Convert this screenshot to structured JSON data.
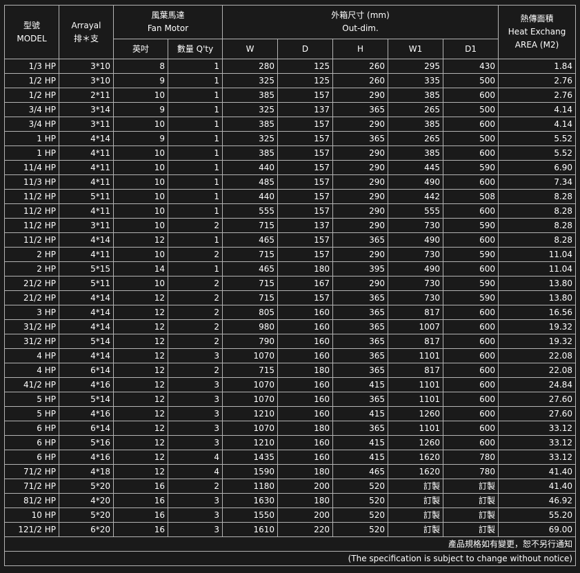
{
  "headers": {
    "model": [
      "型號",
      "MODEL"
    ],
    "arrayal": [
      "Arrayal",
      "排＊支"
    ],
    "fan_motor": [
      "風葉馬達",
      "Fan Motor"
    ],
    "out_dim": [
      "外箱尺寸 (mm)",
      "Out-dim."
    ],
    "heat": [
      "熱傳面積",
      "Heat Exchang",
      "AREA (M2)"
    ],
    "sub": [
      "英吋",
      "數量 Q'ty",
      "W",
      "D",
      "H",
      "W1",
      "D1"
    ]
  },
  "rows": [
    [
      "1/3 HP",
      "3*10",
      "8",
      "1",
      "280",
      "125",
      "260",
      "295",
      "430",
      "1.84"
    ],
    [
      "1/2 HP",
      "3*10",
      "9",
      "1",
      "325",
      "125",
      "260",
      "335",
      "500",
      "2.76"
    ],
    [
      "1/2 HP",
      "2*11",
      "10",
      "1",
      "385",
      "157",
      "290",
      "385",
      "600",
      "2.76"
    ],
    [
      "3/4 HP",
      "3*14",
      "9",
      "1",
      "325",
      "137",
      "365",
      "265",
      "500",
      "4.14"
    ],
    [
      "3/4 HP",
      "3*11",
      "10",
      "1",
      "385",
      "157",
      "290",
      "385",
      "600",
      "4.14"
    ],
    [
      "1 HP",
      "4*14",
      "9",
      "1",
      "325",
      "157",
      "365",
      "265",
      "500",
      "5.52"
    ],
    [
      "1 HP",
      "4*11",
      "10",
      "1",
      "385",
      "157",
      "290",
      "385",
      "600",
      "5.52"
    ],
    [
      "11/4 HP",
      "4*11",
      "10",
      "1",
      "440",
      "157",
      "290",
      "445",
      "590",
      "6.90"
    ],
    [
      "11/3 HP",
      "4*11",
      "10",
      "1",
      "485",
      "157",
      "290",
      "490",
      "600",
      "7.34"
    ],
    [
      "11/2 HP",
      "5*11",
      "10",
      "1",
      "440",
      "157",
      "290",
      "442",
      "508",
      "8.28"
    ],
    [
      "11/2 HP",
      "4*11",
      "10",
      "1",
      "555",
      "157",
      "290",
      "555",
      "600",
      "8.28"
    ],
    [
      "11/2 HP",
      "3*11",
      "10",
      "2",
      "715",
      "137",
      "290",
      "730",
      "590",
      "8.28"
    ],
    [
      "11/2 HP",
      "4*14",
      "12",
      "1",
      "465",
      "157",
      "365",
      "490",
      "600",
      "8.28"
    ],
    [
      "2 HP",
      "4*11",
      "10",
      "2",
      "715",
      "157",
      "290",
      "730",
      "590",
      "11.04"
    ],
    [
      "2 HP",
      "5*15",
      "14",
      "1",
      "465",
      "180",
      "395",
      "490",
      "600",
      "11.04"
    ],
    [
      "21/2 HP",
      "5*11",
      "10",
      "2",
      "715",
      "167",
      "290",
      "730",
      "590",
      "13.80"
    ],
    [
      "21/2 HP",
      "4*14",
      "12",
      "2",
      "715",
      "157",
      "365",
      "730",
      "590",
      "13.80"
    ],
    [
      "3 HP",
      "4*14",
      "12",
      "2",
      "805",
      "160",
      "365",
      "817",
      "600",
      "16.56"
    ],
    [
      "31/2 HP",
      "4*14",
      "12",
      "2",
      "980",
      "160",
      "365",
      "1007",
      "600",
      "19.32"
    ],
    [
      "31/2 HP",
      "5*14",
      "12",
      "2",
      "790",
      "160",
      "365",
      "817",
      "600",
      "19.32"
    ],
    [
      "4 HP",
      "4*14",
      "12",
      "3",
      "1070",
      "160",
      "365",
      "1101",
      "600",
      "22.08"
    ],
    [
      "4 HP",
      "6*14",
      "12",
      "2",
      "715",
      "180",
      "365",
      "817",
      "600",
      "22.08"
    ],
    [
      "41/2 HP",
      "4*16",
      "12",
      "3",
      "1070",
      "160",
      "415",
      "1101",
      "600",
      "24.84"
    ],
    [
      "5 HP",
      "5*14",
      "12",
      "3",
      "1070",
      "160",
      "365",
      "1101",
      "600",
      "27.60"
    ],
    [
      "5 HP",
      "4*16",
      "12",
      "3",
      "1210",
      "160",
      "415",
      "1260",
      "600",
      "27.60"
    ],
    [
      "6 HP",
      "6*14",
      "12",
      "3",
      "1070",
      "180",
      "365",
      "1101",
      "600",
      "33.12"
    ],
    [
      "6 HP",
      "5*16",
      "12",
      "3",
      "1210",
      "160",
      "415",
      "1260",
      "600",
      "33.12"
    ],
    [
      "6 HP",
      "4*16",
      "12",
      "4",
      "1435",
      "160",
      "415",
      "1620",
      "780",
      "33.12"
    ],
    [
      "71/2 HP",
      "4*18",
      "12",
      "4",
      "1590",
      "180",
      "465",
      "1620",
      "780",
      "41.40"
    ],
    [
      "71/2 HP",
      "5*20",
      "16",
      "2",
      "1180",
      "200",
      "520",
      "訂製",
      "訂製",
      "41.40"
    ],
    [
      "81/2 HP",
      "4*20",
      "16",
      "3",
      "1630",
      "180",
      "520",
      "訂製",
      "訂製",
      "46.92"
    ],
    [
      "10 HP",
      "5*20",
      "16",
      "3",
      "1550",
      "200",
      "520",
      "訂製",
      "訂製",
      "55.20"
    ],
    [
      "121/2 HP",
      "6*20",
      "16",
      "3",
      "1610",
      "220",
      "520",
      "訂製",
      "訂製",
      "69.00"
    ]
  ],
  "footer": {
    "zh": "產品規格如有變更，恕不另行通知",
    "en": "(The specification is subject to change without notice)"
  }
}
